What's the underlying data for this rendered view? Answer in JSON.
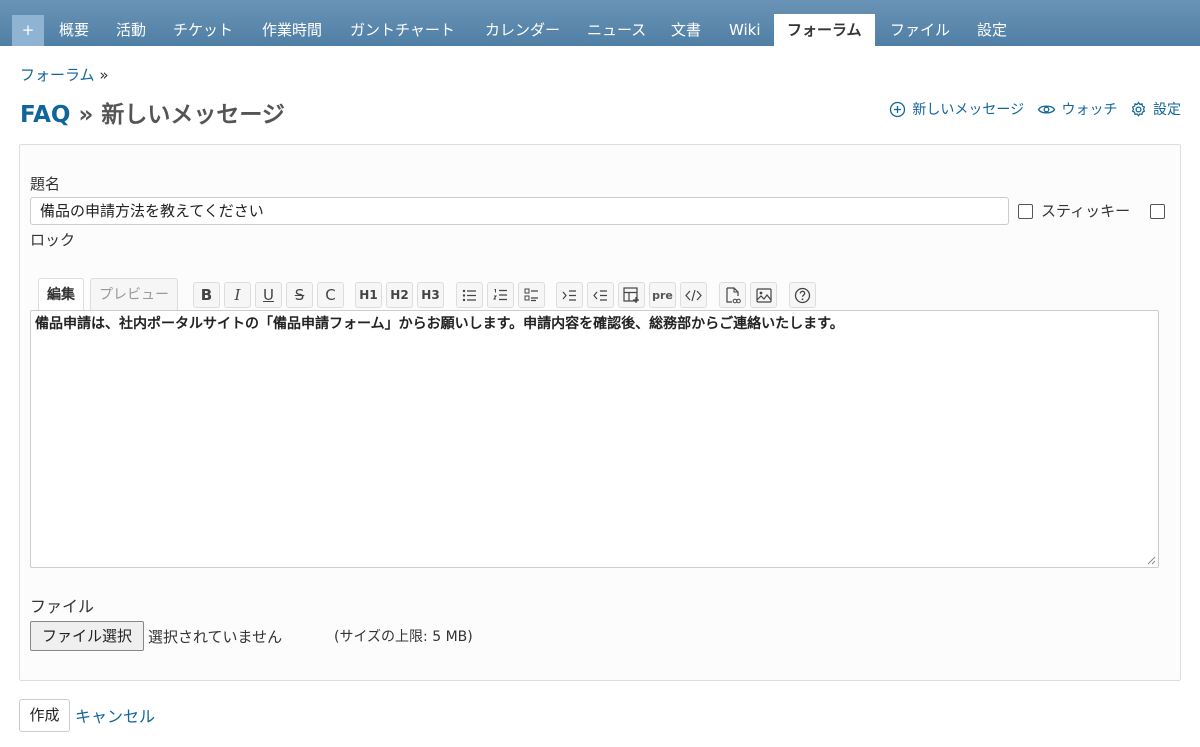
{
  "nav": {
    "plus": "+",
    "tabs": [
      {
        "label": "概要"
      },
      {
        "label": "活動"
      },
      {
        "label": "チケット"
      },
      {
        "label": "作業時間"
      },
      {
        "label": "ガントチャート"
      },
      {
        "label": "カレンダー"
      },
      {
        "label": "ニュース"
      },
      {
        "label": "文書"
      },
      {
        "label": "Wiki"
      },
      {
        "label": "フォーラム",
        "active": true
      },
      {
        "label": "ファイル"
      },
      {
        "label": "設定"
      }
    ]
  },
  "breadcrumb": {
    "link": "フォーラム",
    "sep": "»"
  },
  "heading": {
    "forum": "FAQ",
    "sep": "»",
    "title": "新しいメッセージ"
  },
  "actions": {
    "new_message": "新しいメッセージ",
    "watch": "ウォッチ",
    "settings": "設定"
  },
  "form": {
    "subject_label": "題名",
    "subject_value": "備品の申請方法を教えてください",
    "sticky_label": "スティッキー",
    "lock_label": "ロック",
    "editor_tabs": {
      "edit": "編集",
      "preview": "プレビュー"
    },
    "toolbar": [
      "B",
      "I",
      "U",
      "S",
      "C",
      "H1",
      "H2",
      "H3",
      "ul",
      "ol",
      "task",
      "indent",
      "outdent",
      "table",
      "pre",
      "code",
      "link",
      "image",
      "help"
    ],
    "toolbar_pre": "pre",
    "body": "備品申請は、社内ポータルサイトの「備品申請フォーム」からお願いします。申請内容を確認後、総務部からご連絡いたします。",
    "file_label": "ファイル",
    "file_button": "ファイル選択",
    "file_status": "選択されていません",
    "file_limit": "(サイズの上限: 5 MB)"
  },
  "buttons": {
    "create": "作成",
    "cancel": "キャンセル"
  },
  "colors": {
    "topbar": "#5b87ab",
    "link": "#116699",
    "plus_bg": "#8fb3d3"
  }
}
